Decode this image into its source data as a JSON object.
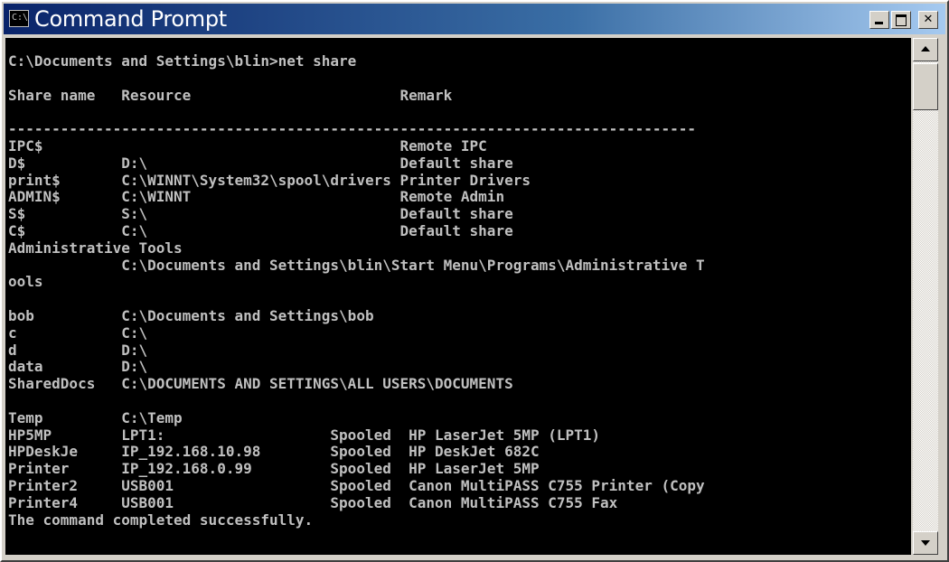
{
  "window": {
    "title": "Command Prompt",
    "icon_label": "C:\\",
    "icon": "cmd-icon",
    "controls": [
      "minimize-icon",
      "maximize-icon",
      "close-icon"
    ]
  },
  "colors": {
    "titlebar_start": "#0a246a",
    "titlebar_end": "#a6caf0",
    "console_bg": "#000000",
    "console_text": "#c0c0c0"
  },
  "console": {
    "lines": [
      "C:\\Documents and Settings\\blin>net share",
      "",
      "Share name   Resource                        Remark",
      "",
      "-------------------------------------------------------------------------------",
      "IPC$                                         Remote IPC",
      "D$           D:\\                             Default share",
      "print$       C:\\WINNT\\System32\\spool\\drivers Printer Drivers",
      "ADMIN$       C:\\WINNT                        Remote Admin",
      "S$           S:\\                             Default share",
      "C$           C:\\                             Default share",
      "Administrative Tools",
      "             C:\\Documents and Settings\\blin\\Start Menu\\Programs\\Administrative T",
      "ools",
      "",
      "bob          C:\\Documents and Settings\\bob",
      "c            C:\\",
      "d            D:\\",
      "data         D:\\",
      "SharedDocs   C:\\DOCUMENTS AND SETTINGS\\ALL USERS\\DOCUMENTS",
      "",
      "Temp         C:\\Temp",
      "HP5MP        LPT1:                   Spooled  HP LaserJet 5MP (LPT1)",
      "HPDeskJe     IP_192.168.10.98        Spooled  HP DeskJet 682C",
      "Printer      IP_192.168.0.99         Spooled  HP LaserJet 5MP",
      "Printer2     USB001                  Spooled  Canon MultiPASS C755 Printer (Copy",
      "Printer4     USB001                  Spooled  Canon MultiPASS C755 Fax",
      "The command completed successfully."
    ]
  }
}
